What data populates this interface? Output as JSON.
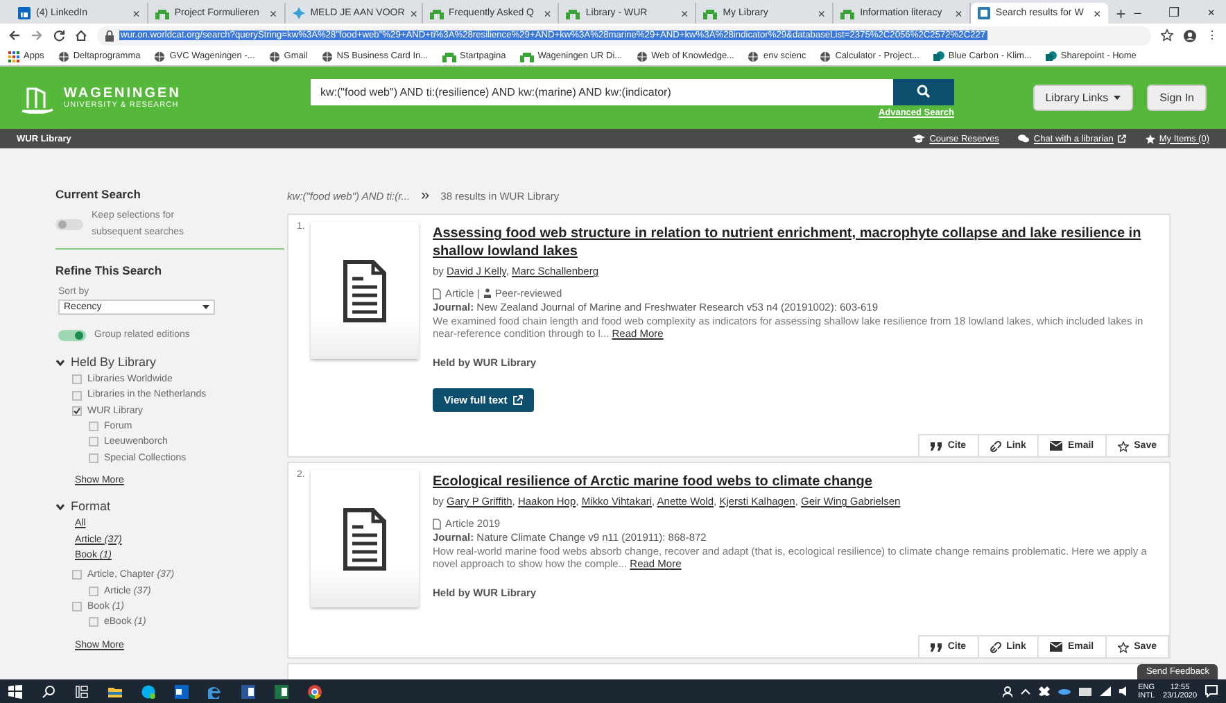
{
  "browser": {
    "tabs": [
      {
        "label": "(4) LinkedIn",
        "kind": "linkedin",
        "selected": false,
        "close": "×"
      },
      {
        "label": "Project Formulieren",
        "kind": "wur",
        "selected": false,
        "close": "×"
      },
      {
        "label": "MELD JE AAN VOOR",
        "kind": "meld",
        "selected": false,
        "close": "×"
      },
      {
        "label": "Frequently Asked Q",
        "kind": "wur",
        "selected": false,
        "close": "×"
      },
      {
        "label": "Library - WUR",
        "kind": "wur",
        "selected": false,
        "close": "×"
      },
      {
        "label": "My Library",
        "kind": "wur",
        "selected": false,
        "close": "×"
      },
      {
        "label": "Information literacy",
        "kind": "wur",
        "selected": false,
        "close": "×"
      },
      {
        "label": "Search results for W",
        "kind": "worldcat",
        "selected": true,
        "close": "×"
      }
    ],
    "new_tab": "+",
    "window_controls": [
      "–",
      "❐",
      "×"
    ],
    "address": "wur.on.worldcat.org/search?queryString=kw%3A%28\"food+web\"%29+AND+ti%3A%28resilience%29+AND+kw%3A%28marine%29+AND+kw%3A%28indicator%29&databaseList=2375%2C2056%2C2572%2C227",
    "menu": "⋮",
    "bookmarks": [
      {
        "label": "Apps",
        "kind": "apps"
      },
      {
        "label": "Deltaprogramma",
        "kind": "globe"
      },
      {
        "label": "GVC Wageningen -...",
        "kind": "globe"
      },
      {
        "label": "Gmail",
        "kind": "globe"
      },
      {
        "label": "NS Business Card In...",
        "kind": "globe"
      },
      {
        "label": "Startpagina",
        "kind": "wur"
      },
      {
        "label": "Wageningen UR Di...",
        "kind": "wur"
      },
      {
        "label": "Web of Knowledge...",
        "kind": "globe"
      },
      {
        "label": "env scienc",
        "kind": "globe"
      },
      {
        "label": "Calculator - Project...",
        "kind": "globe"
      },
      {
        "label": "Blue Carbon - Klim...",
        "kind": "sharepoint"
      },
      {
        "label": "Sharepoint - Home",
        "kind": "sharepoint"
      }
    ]
  },
  "header": {
    "logo_title": "WAGENINGEN",
    "logo_subtitle": "UNIVERSITY & RESEARCH",
    "search_value": "kw:(\"food web\") AND ti:(resilience) AND kw:(marine) AND kw:(indicator)",
    "advanced_search": "Advanced Search",
    "library_links": "Library Links",
    "sign_in": "Sign In"
  },
  "subnav": {
    "title": "WUR Library",
    "links": [
      {
        "label": "Course Reserves",
        "kind": "cap"
      },
      {
        "label": "Chat with a librarian",
        "kind": "chat"
      },
      {
        "label": "My Items (0)",
        "kind": "star"
      }
    ]
  },
  "sidebar": {
    "current_search": "Current Search",
    "keep_toggle": {
      "label": "Keep selections for subsequent searches",
      "on": false
    },
    "refine": "Refine This Search",
    "sort": {
      "label": "Sort by",
      "value": "Recency"
    },
    "group_toggle": {
      "label": "Group related editions",
      "on": true
    },
    "held_by": {
      "title": "Held By Library",
      "expanded": true,
      "options": [
        {
          "label": "Libraries Worldwide",
          "checked": false
        },
        {
          "label": "Libraries in the Netherlands",
          "checked": false
        },
        {
          "label": "WUR Library",
          "checked": true,
          "children": [
            {
              "label": "Forum",
              "checked": false
            },
            {
              "label": "Leeuwenborch",
              "checked": false
            },
            {
              "label": "Special Collections",
              "checked": false
            }
          ]
        }
      ],
      "show_more": "Show More"
    },
    "format": {
      "title": "Format",
      "expanded": true,
      "links": [
        "All",
        "Article *(37)*",
        "Book *(1)*"
      ],
      "options": [
        {
          "label": "Article, Chapter *(37)*",
          "checked": false,
          "children": [
            {
              "label": "Article *(37)*",
              "checked": false
            }
          ]
        },
        {
          "label": "Book *(1)*",
          "checked": false,
          "children": [
            {
              "label": "eBook *(1)*",
              "checked": false
            }
          ]
        }
      ],
      "show_more": "Show More"
    }
  },
  "results": {
    "query": "kw:(\"food web\") AND ti:(r...",
    "separator": "»",
    "count": "38 results in WUR Library",
    "items": [
      {
        "number": "1.",
        "title": "Assessing food web structure in relation to nutrient enrichment, macrophyte collapse and lake resilience in shallow lowland lakes",
        "by": "by",
        "separator": ",",
        "authors": [
          "David J Kelly",
          "Marc Schallenberg"
        ],
        "format": "Article |",
        "peer_review": "Peer-reviewed",
        "journal": "**Journal:** New Zealand Journal of Marine and Freshwater Research v53 n4 (20191002): 603-619",
        "abstract": "We examined food chain length and food web complexity as indicators for assessing shallow lake resilience from 18 lowland lakes, which included lakes in near-reference condition through to l...",
        "read_more": "Read More",
        "held": "Held by WUR Library",
        "full_text": "View full text",
        "actions": [
          {
            "label": "Cite",
            "kind": "cite"
          },
          {
            "label": "Link",
            "kind": "link"
          },
          {
            "label": "Email",
            "kind": "email"
          },
          {
            "label": "Save",
            "kind": "save"
          }
        ]
      },
      {
        "number": "2.",
        "title": "Ecological resilience of Arctic marine food webs to climate change",
        "by": "by",
        "separator": ",",
        "authors": [
          "Gary P Griffith",
          "Haakon Hop",
          "Mikko Vihtakari",
          "Anette Wold",
          "Kjersti Kalhagen",
          "Geir Wing Gabrielsen"
        ],
        "format": "Article 2019",
        "journal": "**Journal:** Nature Climate Change v9 n11 (201911): 868-872",
        "abstract": "How real-world marine food webs absorb change, recover and adapt (that is, ecological resilience) to climate change remains problematic. Here we apply a novel approach to show how the comple...",
        "read_more": "Read More",
        "held": "Held by WUR Library",
        "actions": [
          {
            "label": "Cite",
            "kind": "cite"
          },
          {
            "label": "Link",
            "kind": "link"
          },
          {
            "label": "Email",
            "kind": "email"
          },
          {
            "label": "Save",
            "kind": "save"
          }
        ]
      }
    ]
  },
  "feedback": "Send Feedback",
  "taskbar": {
    "apps": [
      {
        "kind": "windows"
      },
      {
        "kind": "search"
      },
      {
        "kind": "taskview"
      },
      {
        "kind": "explorer"
      },
      {
        "kind": "skype"
      },
      {
        "kind": "outlook"
      },
      {
        "kind": "edge"
      },
      {
        "kind": "word"
      },
      {
        "kind": "excel"
      },
      {
        "kind": "chrome"
      }
    ],
    "language": [
      "ENG",
      "INTL"
    ],
    "time": "12:55",
    "date": "23/1/2020"
  }
}
